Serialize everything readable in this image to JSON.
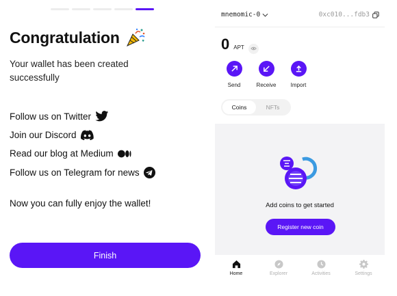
{
  "onboarding": {
    "total_steps": 5,
    "current_step": 5,
    "title": "Congratulation",
    "subtitle": "Your wallet has been created successfully",
    "socials": [
      {
        "label": "Follow us on Twitter",
        "icon": "twitter-icon"
      },
      {
        "label": "Join our Discord",
        "icon": "discord-icon"
      },
      {
        "label": "Read our blog at Medium",
        "icon": "medium-icon"
      },
      {
        "label": "Follow us on Telegram for news",
        "icon": "telegram-icon"
      }
    ],
    "enjoy_text": "Now you can fully enjoy the wallet!",
    "finish_label": "Finish",
    "accent_color": "#5a16f6"
  },
  "wallet": {
    "account_name": "mnemomic-0",
    "address": "0xc010...fdb3",
    "balance": "0",
    "unit": "APT",
    "actions": [
      {
        "label": "Send",
        "icon": "send-arrow-icon"
      },
      {
        "label": "Receive",
        "icon": "receive-arrow-icon"
      },
      {
        "label": "Import",
        "icon": "import-icon"
      }
    ],
    "tabs": [
      {
        "label": "Coins",
        "active": true
      },
      {
        "label": "NFTs",
        "active": false
      }
    ],
    "empty_text": "Add coins to get started",
    "register_label": "Register new coin",
    "nav": [
      {
        "label": "Home",
        "icon": "home-icon",
        "active": true
      },
      {
        "label": "Explorer",
        "icon": "compass-icon",
        "active": false
      },
      {
        "label": "Activities",
        "icon": "clock-icon",
        "active": false
      },
      {
        "label": "Settings",
        "icon": "gear-icon",
        "active": false
      }
    ]
  }
}
